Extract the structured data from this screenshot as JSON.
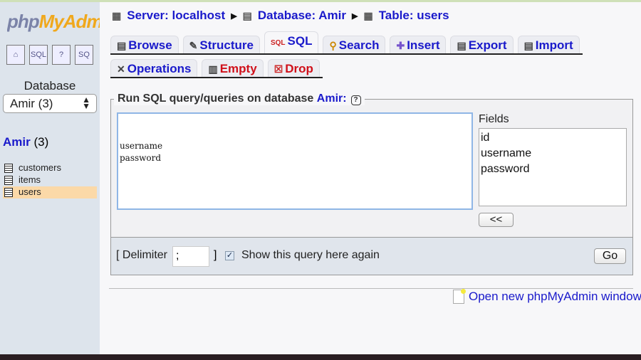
{
  "sidebar": {
    "logo_a": "php",
    "logo_b": "MyAdmin",
    "icons": [
      "home-icon",
      "sql-query-window-icon",
      "help-icon",
      "sql-docs-icon"
    ],
    "database_label": "Database",
    "database_select": "Amir (3)",
    "db_name": "Amir",
    "db_count": "(3)",
    "tables": [
      "customers",
      "items",
      "users"
    ],
    "selected_table": "users"
  },
  "breadcrumb": {
    "server": "Server: localhost",
    "database": "Database: Amir",
    "table": "Table: users"
  },
  "tabs": {
    "row1": [
      "Browse",
      "Structure",
      "SQL",
      "Search",
      "Insert",
      "Export",
      "Import"
    ],
    "row2": [
      "Operations",
      "Empty",
      "Drop"
    ],
    "active": "SQL"
  },
  "sql": {
    "legend": "Run SQL query/queries on database",
    "legend_db": "Amir:",
    "query": "\nusername\npassword",
    "fields_label": "Fields",
    "fields": [
      "id",
      "username",
      "password"
    ],
    "insert_button": "<<",
    "delimiter_label": "[ Delimiter",
    "delimiter_value": ";",
    "delimiter_close": "]",
    "show_again_label": "Show this query here again",
    "show_again_checked": true,
    "go_button": "Go"
  },
  "footer": {
    "new_window_link": "Open new phpMyAdmin window"
  }
}
